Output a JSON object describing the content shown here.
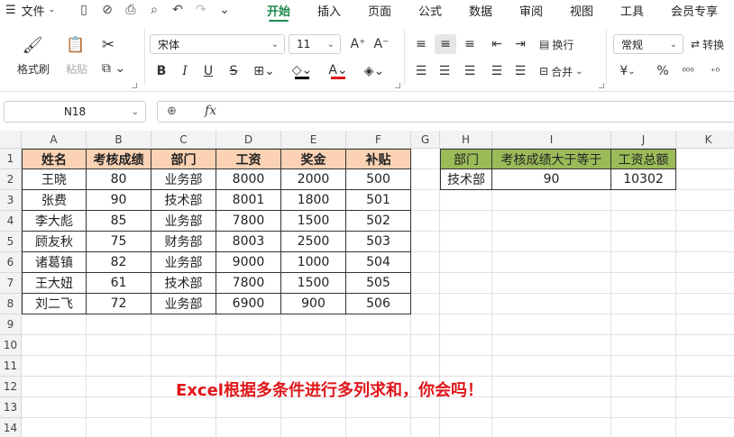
{
  "menubar": {
    "file_label": "文件",
    "tabs": [
      "开始",
      "插入",
      "页面",
      "公式",
      "数据",
      "审阅",
      "视图",
      "工具",
      "会员专享"
    ],
    "active_tab": "开始"
  },
  "ribbon": {
    "format_painter": "格式刷",
    "paste": "粘贴",
    "font_name": "宋体",
    "font_size": "11",
    "wrap": "换行",
    "merge": "合并",
    "number_format": "常规",
    "convert": "转换",
    "currency_symbol": "¥",
    "percent_symbol": "%"
  },
  "formula_bar": {
    "name_box": "N18",
    "fx_label": "fx",
    "formula": ""
  },
  "columns": [
    "A",
    "B",
    "C",
    "D",
    "E",
    "F",
    "G",
    "H",
    "I",
    "J",
    "K"
  ],
  "rows": [
    "1",
    "2",
    "3",
    "4",
    "5",
    "6",
    "7",
    "8",
    "9",
    "10",
    "11",
    "12",
    "13",
    "14"
  ],
  "table1": {
    "headers": [
      "姓名",
      "考核成绩",
      "部门",
      "工资",
      "奖金",
      "补贴"
    ],
    "rows": [
      [
        "王晓",
        "80",
        "业务部",
        "8000",
        "2000",
        "500"
      ],
      [
        "张费",
        "90",
        "技术部",
        "8001",
        "1800",
        "501"
      ],
      [
        "李大彪",
        "85",
        "业务部",
        "7800",
        "1500",
        "502"
      ],
      [
        "顾友秋",
        "75",
        "财务部",
        "8003",
        "2500",
        "503"
      ],
      [
        "诸葛镇",
        "82",
        "业务部",
        "9000",
        "1000",
        "504"
      ],
      [
        "王大妞",
        "61",
        "技术部",
        "7800",
        "1500",
        "505"
      ],
      [
        "刘二飞",
        "72",
        "业务部",
        "6900",
        "900",
        "506"
      ]
    ],
    "header_color": "#fbd3b4"
  },
  "table2": {
    "headers": [
      "部门",
      "考核成绩大于等于",
      "工资总额"
    ],
    "row": [
      "技术部",
      "90",
      "10302"
    ],
    "header_color": "#9bbb59"
  },
  "caption": "Excel根据多条件进行多列求和，你会吗！",
  "colors": {
    "accent": "#1a8a4d",
    "caption": "#e0161a",
    "font_color_bar": "#e0161a"
  }
}
